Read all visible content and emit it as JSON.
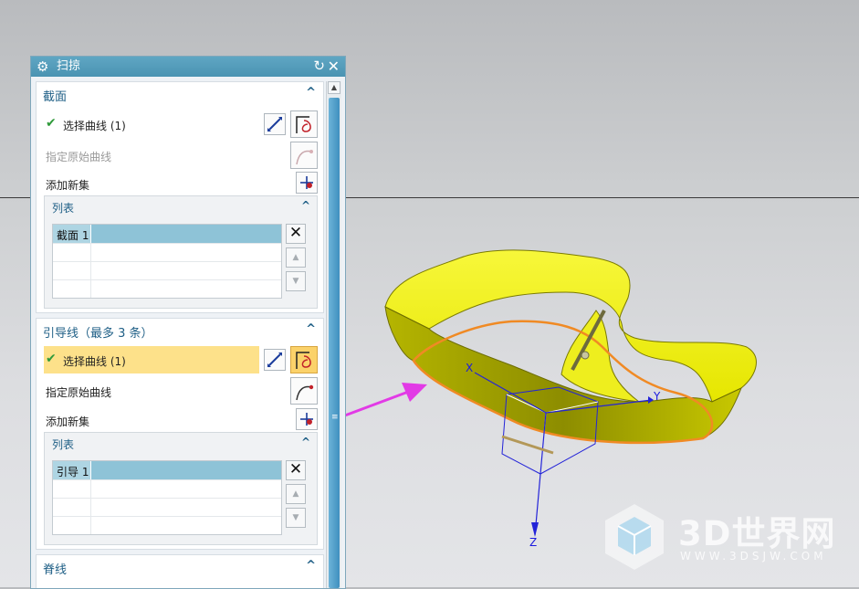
{
  "dialog": {
    "title": "扫掠",
    "icons": {
      "settings": "gear-icon",
      "reset": "reset-icon",
      "close": "close-icon"
    },
    "section": {
      "title": "截面",
      "select_curve": "选择曲线 (1)",
      "specify_origin": "指定原始曲线",
      "add_new_set": "添加新集",
      "list_title": "列表",
      "list_items": [
        "截面 1"
      ]
    },
    "guide": {
      "title": "引导线（最多 3 条）",
      "select_curve": "选择曲线 (1)",
      "specify_origin": "指定原始曲线",
      "add_new_set": "添加新集",
      "list_title": "列表",
      "list_items": [
        "引导 1"
      ]
    },
    "spine": {
      "title": "脊线"
    }
  },
  "viewport": {
    "axis_labels": {
      "x": "X",
      "y": "Y",
      "z": "Z"
    },
    "colors": {
      "surface": "#f2f200",
      "edge": "#f08a24",
      "annotation_arrow": "#e23ae6",
      "axes": "#1a1adf"
    }
  },
  "watermark": {
    "main": "3D世界网",
    "sub": "WWW.3DSJW.COM"
  }
}
